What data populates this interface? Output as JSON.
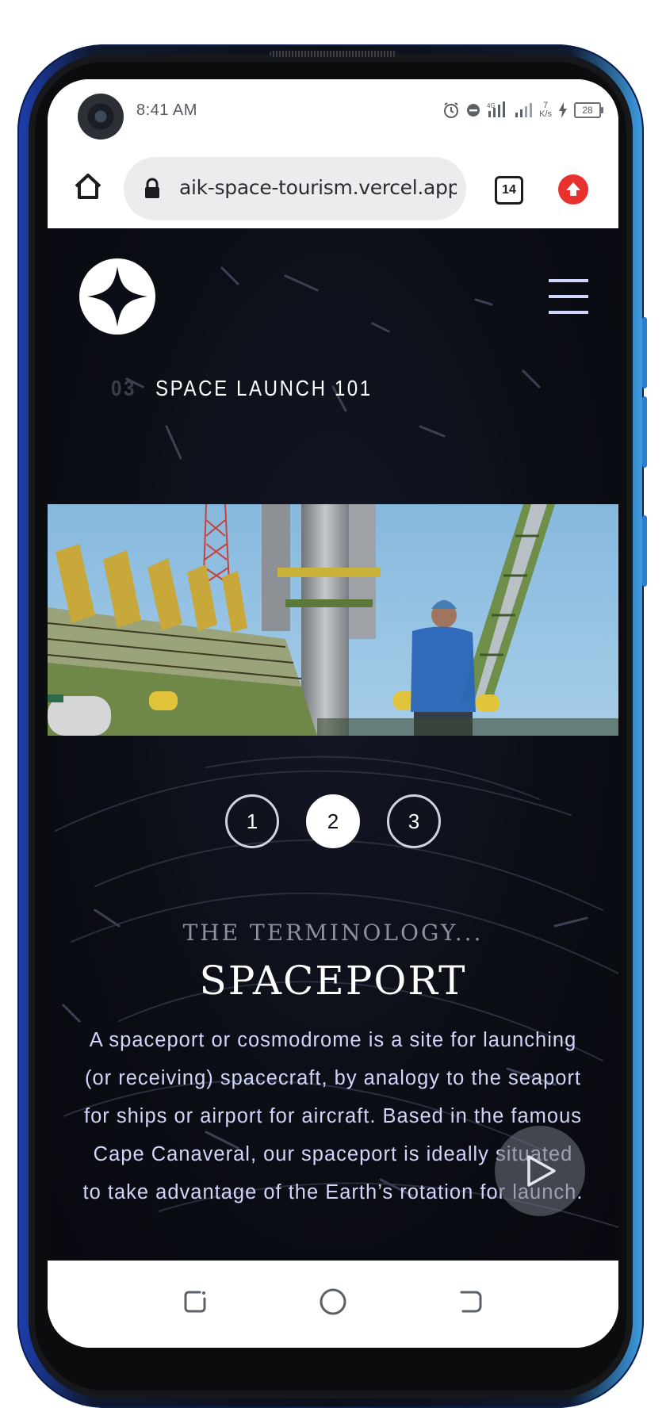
{
  "status_bar": {
    "time": "8:41 AM",
    "network_speed_value": "7",
    "network_speed_unit": "K/s",
    "battery_level": "28"
  },
  "browser": {
    "url": "aik-space-tourism.vercel.app/techn",
    "tab_count": "14"
  },
  "site": {
    "page_number": "03",
    "page_title": "SPACE LAUNCH 101",
    "pager": [
      "1",
      "2",
      "3"
    ],
    "active_page": "2",
    "eyebrow": "THE TERMINOLOGY...",
    "term": "SPACEPORT",
    "description": "A spaceport or cosmodrome is a site for launching (or receiving) spacecraft, by analogy to the seaport for ships or airport for aircraft. Based in the famous Cape Canaveral, our spaceport is ideally situated to take advantage of the Earth’s rotation for launch."
  },
  "icons": {
    "home": "home-icon",
    "lock": "lock-icon",
    "tabs": "tabs-icon",
    "upload": "upload-icon",
    "logo": "star-logo-icon",
    "menu": "hamburger-menu-icon",
    "play": "play-icon",
    "recents": "recents-icon",
    "home_nav": "home-circle-icon",
    "back": "back-icon"
  },
  "colors": {
    "background": "#0b0d17",
    "accent_text": "#d0d6f9",
    "muted_number": "#3b3e4a",
    "upload_button": "#e8322f",
    "frame_blue": "#2b7fd0"
  }
}
